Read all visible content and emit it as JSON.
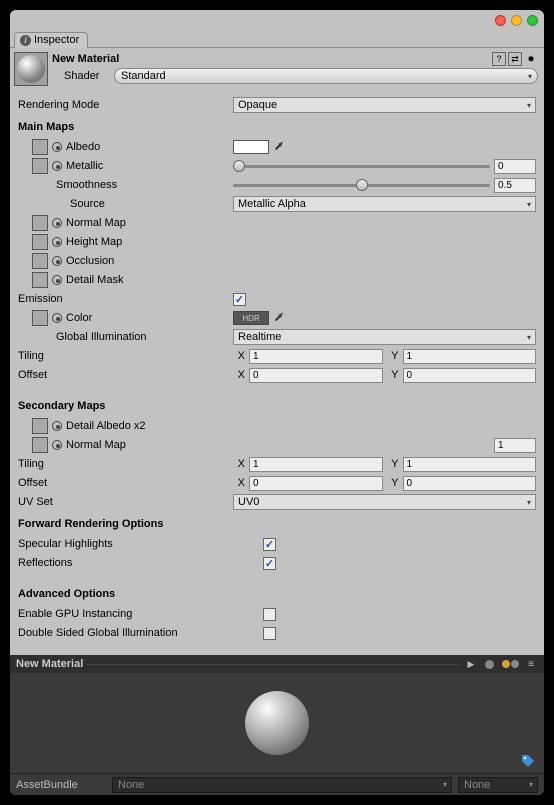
{
  "tab": {
    "title": "Inspector"
  },
  "header": {
    "material_name": "New Material",
    "shader_label": "Shader",
    "shader_value": "Standard"
  },
  "rendering_mode": {
    "label": "Rendering Mode",
    "value": "Opaque"
  },
  "main_maps": {
    "title": "Main Maps",
    "albedo": "Albedo",
    "metallic": "Metallic",
    "metallic_value": "0",
    "smoothness": "Smoothness",
    "smoothness_value": "0.5",
    "source": "Source",
    "source_value": "Metallic Alpha",
    "normal_map": "Normal Map",
    "height_map": "Height Map",
    "occlusion": "Occlusion",
    "detail_mask": "Detail Mask"
  },
  "emission": {
    "label": "Emission",
    "checked": true,
    "color": "Color",
    "hdr": "HDR",
    "gi_label": "Global Illumination",
    "gi_value": "Realtime"
  },
  "tiling": {
    "label": "Tiling",
    "x_label": "X",
    "x": "1",
    "y_label": "Y",
    "y": "1"
  },
  "offset": {
    "label": "Offset",
    "x_label": "X",
    "x": "0",
    "y_label": "Y",
    "y": "0"
  },
  "secondary": {
    "title": "Secondary Maps",
    "detail_albedo": "Detail Albedo x2",
    "normal_map": "Normal Map",
    "normal_value": "1",
    "tiling": {
      "label": "Tiling",
      "x": "1",
      "y": "1"
    },
    "offset": {
      "label": "Offset",
      "x": "0",
      "y": "0"
    },
    "uv_label": "UV Set",
    "uv_value": "UV0"
  },
  "forward": {
    "title": "Forward Rendering Options",
    "specular": "Specular Highlights",
    "reflections": "Reflections"
  },
  "advanced": {
    "title": "Advanced Options",
    "gpu": "Enable GPU Instancing",
    "double_sided": "Double Sided Global Illumination"
  },
  "preview": {
    "name": "New Material"
  },
  "assetbundle": {
    "label": "AssetBundle",
    "value1": "None",
    "value2": "None"
  }
}
